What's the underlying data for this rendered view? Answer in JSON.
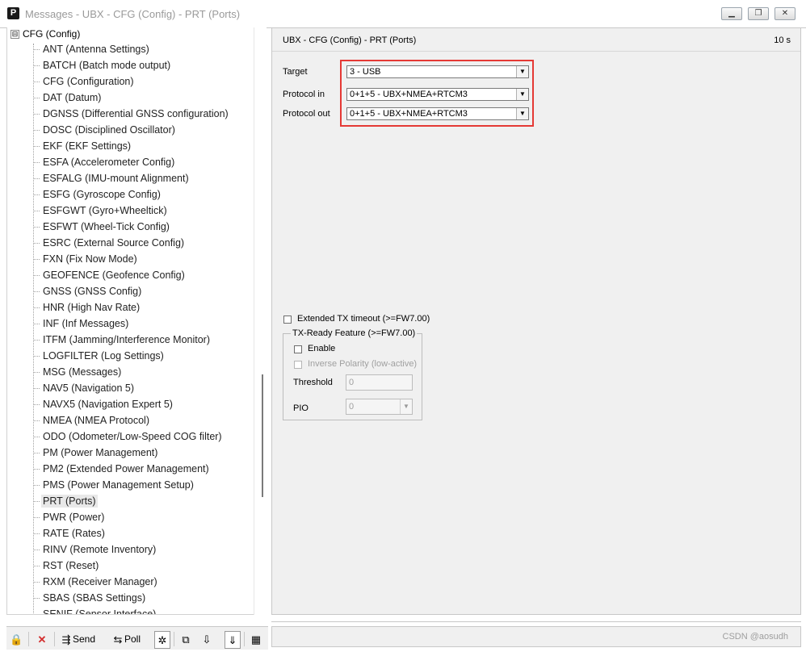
{
  "window": {
    "title": "Messages - UBX - CFG (Config) - PRT (Ports)",
    "app_icon": "P",
    "controls": [
      "minimize-icon",
      "restore-icon",
      "close-icon"
    ]
  },
  "tree": {
    "root": {
      "label": "CFG (Config)",
      "expander": "⊟"
    },
    "items": [
      "ANT (Antenna Settings)",
      "BATCH (Batch mode output)",
      "CFG (Configuration)",
      "DAT (Datum)",
      "DGNSS (Differential GNSS configuration)",
      "DOSC (Disciplined Oscillator)",
      "EKF (EKF Settings)",
      "ESFA (Accelerometer Config)",
      "ESFALG (IMU-mount Alignment)",
      "ESFG (Gyroscope Config)",
      "ESFGWT (Gyro+Wheeltick)",
      "ESFWT (Wheel-Tick Config)",
      "ESRC (External Source Config)",
      "FXN (Fix Now Mode)",
      "GEOFENCE (Geofence Config)",
      "GNSS (GNSS Config)",
      "HNR (High Nav Rate)",
      "INF (Inf Messages)",
      "ITFM (Jamming/Interference Monitor)",
      "LOGFILTER (Log Settings)",
      "MSG (Messages)",
      "NAV5 (Navigation 5)",
      "NAVX5 (Navigation Expert 5)",
      "NMEA (NMEA Protocol)",
      "ODO (Odometer/Low-Speed COG filter)",
      "PM (Power Management)",
      "PM2 (Extended Power Management)",
      "PMS (Power Management Setup)",
      "PRT (Ports)",
      "PWR (Power)",
      "RATE (Rates)",
      "RINV (Remote Inventory)",
      "RST (Reset)",
      "RXM (Receiver Manager)",
      "SBAS (SBAS Settings)",
      "SENIF (Sensor Interface)"
    ],
    "selected_index": 28
  },
  "panel": {
    "title": "UBX - CFG (Config) - PRT (Ports)",
    "time": "10 s",
    "target_label": "Target",
    "target_value": "3 - USB",
    "protocol_in_label": "Protocol in",
    "protocol_in_value": "0+1+5 - UBX+NMEA+RTCM3",
    "protocol_out_label": "Protocol out",
    "protocol_out_value": "0+1+5 - UBX+NMEA+RTCM3",
    "extended_tx_label": "Extended TX timeout (>=FW7.00)",
    "txready_legend": "TX-Ready Feature (>=FW7.00)",
    "enable_label": "Enable",
    "inverse_label": "Inverse Polarity (low-active)",
    "threshold_label": "Threshold",
    "threshold_value": "0",
    "pio_label": "PIO",
    "pio_value": "0"
  },
  "toolbar": {
    "send_label": "Send",
    "poll_label": "Poll"
  },
  "status": {
    "watermark": "CSDN @aosudh"
  }
}
